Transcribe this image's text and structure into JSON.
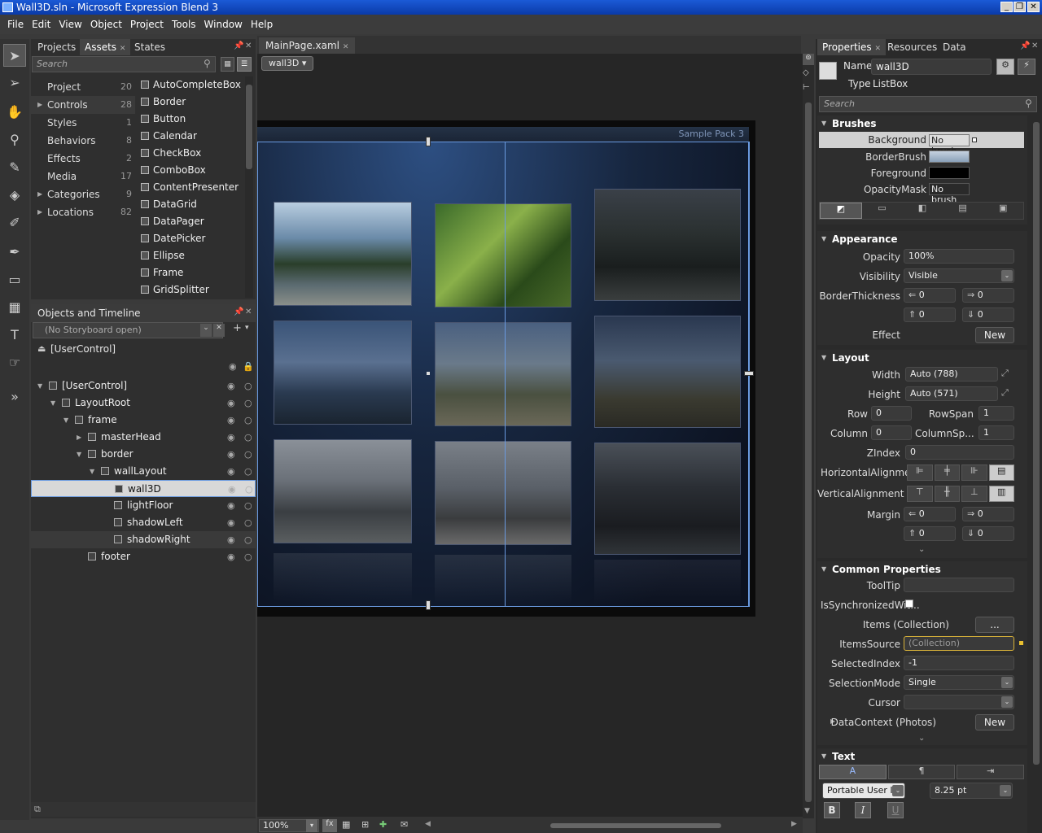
{
  "window": {
    "title": "Wall3D.sln - Microsoft Expression Blend 3"
  },
  "menu": [
    "File",
    "Edit",
    "View",
    "Object",
    "Project",
    "Tools",
    "Window",
    "Help"
  ],
  "left_tabs": [
    "Projects",
    "Assets",
    "States"
  ],
  "assets_search_placeholder": "Search",
  "categories": [
    {
      "label": "Project",
      "count": "20",
      "arrow": ""
    },
    {
      "label": "Controls",
      "count": "28",
      "arrow": "▶"
    },
    {
      "label": "Styles",
      "count": "1",
      "arrow": ""
    },
    {
      "label": "Behaviors",
      "count": "8",
      "arrow": ""
    },
    {
      "label": "Effects",
      "count": "2",
      "arrow": ""
    },
    {
      "label": "Media",
      "count": "17",
      "arrow": ""
    },
    {
      "label": "Categories",
      "count": "9",
      "arrow": "▶"
    },
    {
      "label": "Locations",
      "count": "82",
      "arrow": "▶"
    }
  ],
  "assets": [
    "AutoCompleteBox",
    "Border",
    "Button",
    "Calendar",
    "CheckBox",
    "ComboBox",
    "ContentPresenter",
    "DataGrid",
    "DataPager",
    "DatePicker",
    "Ellipse",
    "Frame",
    "GridSplitter"
  ],
  "objects": {
    "title": "Objects and Timeline",
    "storyboard": "(No Storyboard open)",
    "scope": "[UserControl]",
    "tree": [
      {
        "label": "[UserControl]",
        "indent": 0
      },
      {
        "label": "LayoutRoot",
        "indent": 1
      },
      {
        "label": "frame",
        "indent": 2
      },
      {
        "label": "masterHead",
        "indent": 3
      },
      {
        "label": "border",
        "indent": 3
      },
      {
        "label": "wallLayout",
        "indent": 4
      },
      {
        "label": "wall3D",
        "indent": 5
      },
      {
        "label": "lightFloor",
        "indent": 5
      },
      {
        "label": "shadowLeft",
        "indent": 5
      },
      {
        "label": "shadowRight",
        "indent": 5
      },
      {
        "label": "footer",
        "indent": 3
      }
    ]
  },
  "document": {
    "tab": "MainPage.xaml",
    "breadcrumb": "wall3D",
    "header_text": "Sample Pack 3",
    "zoom": "100%"
  },
  "right_tabs": [
    "Properties",
    "Resources",
    "Data"
  ],
  "properties": {
    "name_label": "Name",
    "name_value": "wall3D",
    "type_label": "Type",
    "type_value": "ListBox",
    "search_placeholder": "Search",
    "brushes": {
      "title": "Brushes",
      "rows": [
        {
          "label": "Background",
          "value": "No brush"
        },
        {
          "label": "BorderBrush",
          "value": ""
        },
        {
          "label": "Foreground",
          "value": ""
        },
        {
          "label": "OpacityMask",
          "value": "No brush"
        }
      ]
    },
    "appearance": {
      "title": "Appearance",
      "opacity_label": "Opacity",
      "opacity": "100%",
      "visibility_label": "Visibility",
      "visibility": "Visible",
      "borderthickness_label": "BorderThickness",
      "bt": [
        "0",
        "0",
        "0",
        "0"
      ],
      "effect_label": "Effect",
      "new_label": "New"
    },
    "layout": {
      "title": "Layout",
      "width_label": "Width",
      "width": "Auto (788)",
      "height_label": "Height",
      "height": "Auto (571)",
      "row_label": "Row",
      "row": "0",
      "rowspan_label": "RowSpan",
      "rowspan": "1",
      "column_label": "Column",
      "column": "0",
      "columnspan_label": "ColumnSp...",
      "columnspan": "1",
      "zindex_label": "ZIndex",
      "zindex": "0",
      "halign_label": "HorizontalAlignme...",
      "valign_label": "VerticalAlignment",
      "margin_label": "Margin",
      "margin": [
        "0",
        "0",
        "0",
        "0"
      ]
    },
    "common": {
      "title": "Common Properties",
      "tooltip_label": "ToolTip",
      "issync_label": "IsSynchronizedWit...",
      "items_label": "Items (Collection)",
      "items_btn": "...",
      "itemssource_label": "ItemsSource",
      "itemssource": "(Collection)",
      "selectedindex_label": "SelectedIndex",
      "selectedindex": "-1",
      "selectionmode_label": "SelectionMode",
      "selectionmode": "Single",
      "cursor_label": "Cursor",
      "datacontext_label": "DataContext (Photos)",
      "datacontext_btn": "New"
    },
    "text": {
      "title": "Text",
      "font": "Portable User In",
      "size": "8.25 pt",
      "bold": "B",
      "italic": "I",
      "underline": "U"
    }
  },
  "colors": {
    "accent": "#6a9ae0",
    "selection": "#d0d0d0",
    "title_blue": "#0a3aa8"
  }
}
